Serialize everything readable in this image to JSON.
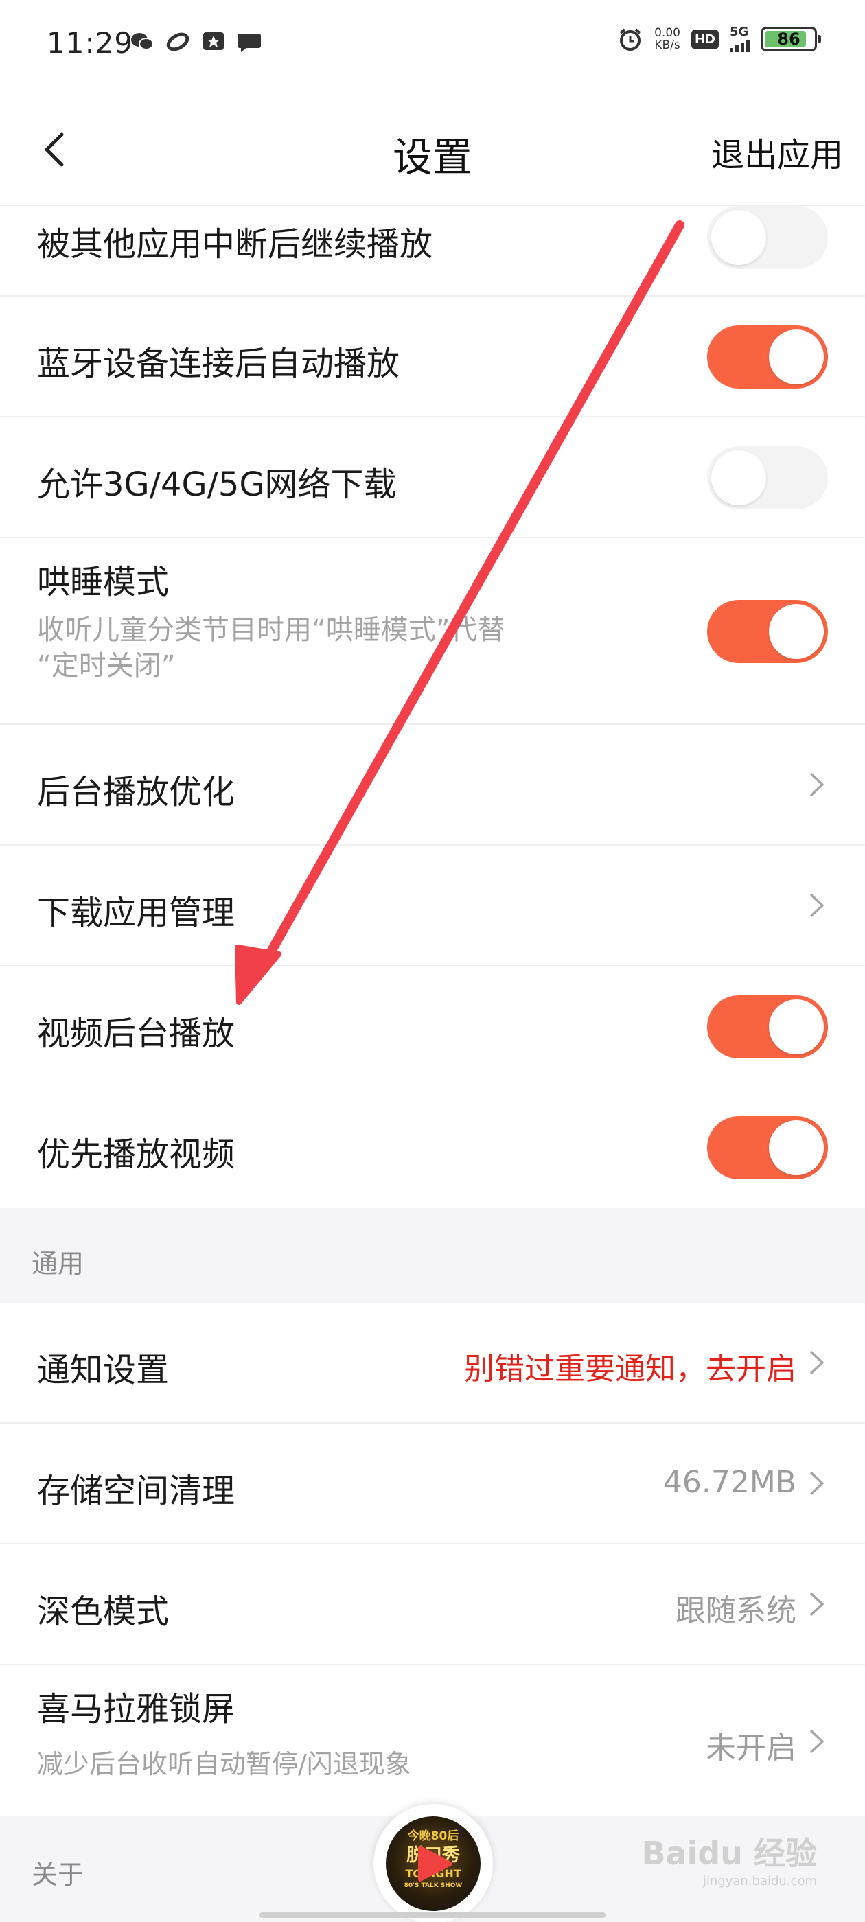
{
  "status_bar": {
    "time": "11:29",
    "left_icons": [
      "wechat-icon",
      "link-app-icon",
      "star-badge-icon",
      "message-bubble-icon"
    ],
    "net_speed_value": "0.00",
    "net_speed_unit": "KB/s",
    "hd": "HD",
    "network": "5G",
    "battery": "86",
    "battery_level": 0.86
  },
  "header": {
    "title": "设置",
    "exit_label": "退出应用"
  },
  "settings": [
    {
      "label": "被其他应用中断后继续播放",
      "type": "toggle",
      "on": false
    },
    {
      "label": "蓝牙设备连接后自动播放",
      "type": "toggle",
      "on": true
    },
    {
      "label": "允许3G/4G/5G网络下载",
      "type": "toggle",
      "on": false
    },
    {
      "label": "哄睡模式",
      "sub1": "收听儿童分类节目时用“哄睡模式”代替",
      "sub2": "“定时关闭”",
      "type": "toggle",
      "on": true
    },
    {
      "label": "后台播放优化",
      "type": "link"
    },
    {
      "label": "下载应用管理",
      "type": "link"
    },
    {
      "label": "视频后台播放",
      "type": "toggle",
      "on": true
    },
    {
      "label": "优先播放视频",
      "type": "toggle",
      "on": true
    }
  ],
  "general": {
    "section_title": "通用",
    "items": [
      {
        "label": "通知设置",
        "value": "别错过重要通知，去开启"
      },
      {
        "label": "存储空间清理",
        "value": "46.72MB"
      },
      {
        "label": "深色模式",
        "value": "跟随系统"
      },
      {
        "label": "喜马拉雅锁屏",
        "sub": "减少后台收听自动暂停/闪退现象",
        "value": "未开启"
      }
    ]
  },
  "about": {
    "section_title": "关于"
  },
  "player": {
    "cover_line1": "今晚80后",
    "cover_line2": "脱口秀",
    "cover_line3": "TONIGHT",
    "cover_line4": "80'S TALK SHOW"
  },
  "watermark": {
    "text": "Baidu 经验",
    "url": "jingyan.baidu.com"
  },
  "colors": {
    "toggle_on": "#f86442",
    "toggle_off": "#f3f3f3",
    "notify_value": "#e0241c",
    "arrow": "#f2404a"
  }
}
